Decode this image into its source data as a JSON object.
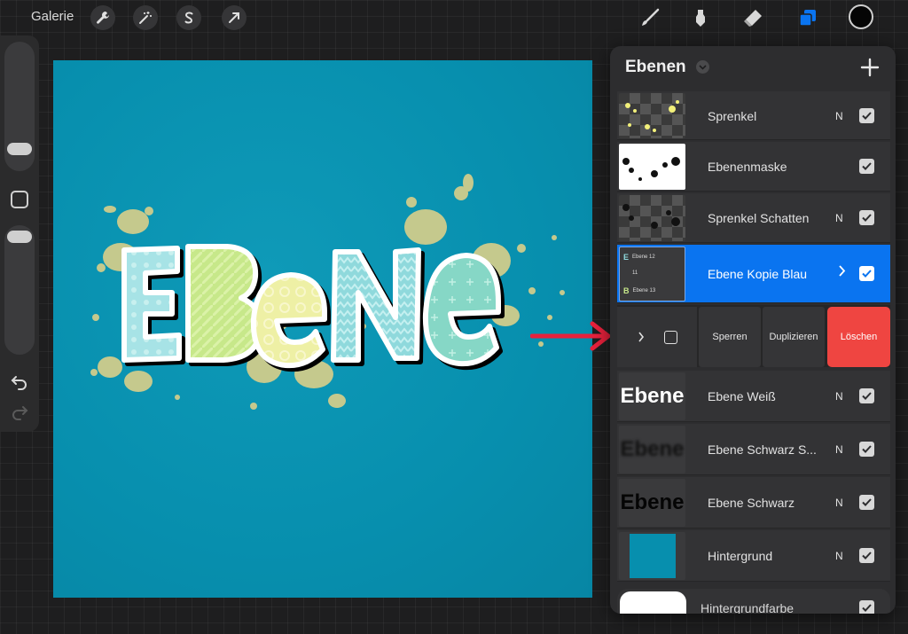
{
  "topbar": {
    "gallery_label": "Galerie",
    "left_tools": [
      "wrench-icon",
      "magic-wand-icon",
      "selection-s-icon",
      "arrow-cursor-icon"
    ],
    "right_tools": [
      "brush-icon",
      "smudge-icon",
      "eraser-icon",
      "layers-icon"
    ],
    "active_color": "#050505",
    "accent": "#0a74f0"
  },
  "canvas": {
    "word": "EBeNe",
    "background": "#078fae",
    "splatter_color": "#c5c98d"
  },
  "layers_panel": {
    "title": "Ebenen",
    "add_label": "+",
    "layers": [
      {
        "name": "Sprenkel",
        "blend": "N",
        "visible": true,
        "thumb": "splatter"
      },
      {
        "name": "Ebenenmaske",
        "blend": "",
        "visible": true,
        "thumb": "mask"
      },
      {
        "name": "Sprenkel Schatten",
        "blend": "N",
        "visible": true,
        "thumb": "splatter-dark"
      },
      {
        "name": "Ebene Kopie Blau",
        "blend": "",
        "visible": true,
        "thumb": "group",
        "active": true
      },
      {
        "name": "Ebene Weiß",
        "blend": "N",
        "visible": true,
        "thumb": "text-white"
      },
      {
        "name": "Ebene Schwarz S...",
        "blend": "N",
        "visible": true,
        "thumb": "text-blur"
      },
      {
        "name": "Ebene Schwarz",
        "blend": "N",
        "visible": true,
        "thumb": "text-black"
      },
      {
        "name": "Hintergrund",
        "blend": "N",
        "visible": true,
        "thumb": "solid-blue"
      },
      {
        "name": "Hintergrundfarbe",
        "blend": "",
        "visible": true,
        "thumb": "white"
      }
    ],
    "thumb_text": "Ebene",
    "group_thumb_items": [
      {
        "letter": "E",
        "name": "Ebene 12"
      },
      {
        "letter": "",
        "name": "11"
      },
      {
        "letter": "B",
        "name": "Ebene 13"
      }
    ],
    "actions": {
      "lock": "Sperren",
      "duplicate": "Duplizieren",
      "delete": "Löschen"
    },
    "delete_color": "#ef4541"
  }
}
